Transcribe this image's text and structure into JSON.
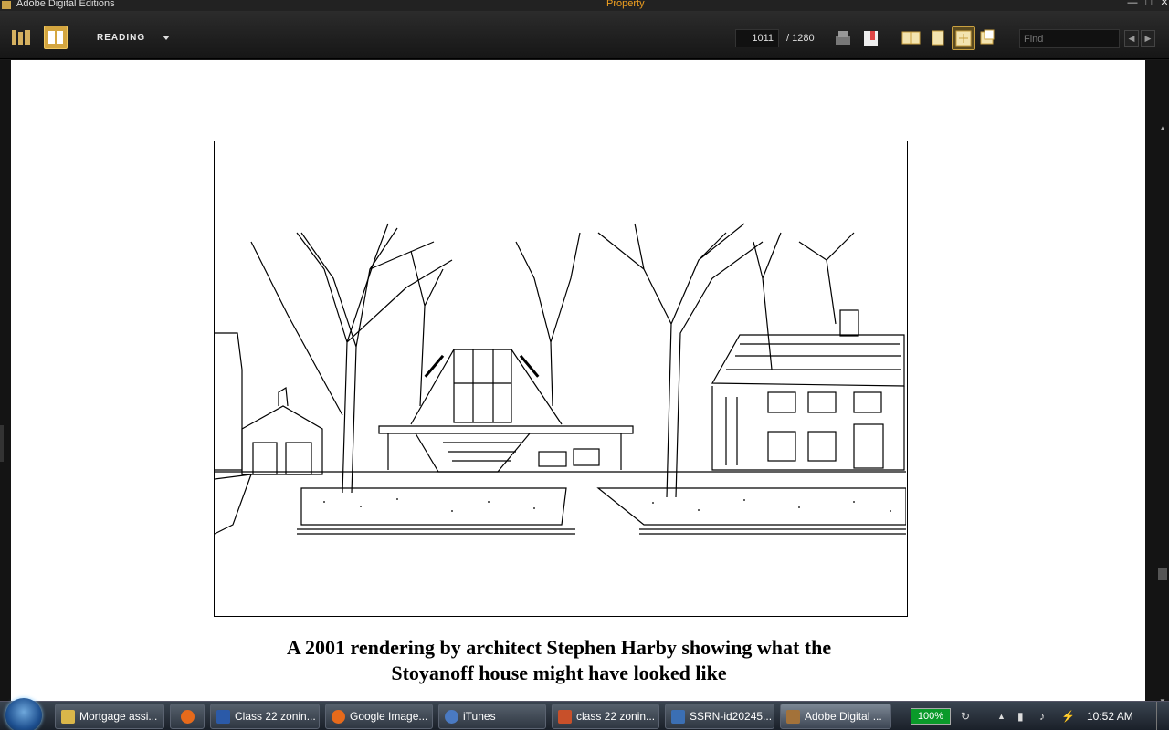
{
  "window": {
    "app_title": "Adobe Digital Editions",
    "doc_title": "Property"
  },
  "toolbar": {
    "view_mode_label": "READING",
    "page_current": "1011",
    "page_total": "/ 1280",
    "find_placeholder": "Find"
  },
  "document": {
    "caption_line1": "A 2001 rendering by architect Stephen Harby showing what the",
    "caption_line2": "Stoyanoff house might have looked like"
  },
  "taskbar": {
    "items": [
      {
        "label": "Mortgage assi...",
        "icon": "folder-icon",
        "color": "#d9b64a"
      },
      {
        "label": "",
        "icon": "firefox-icon",
        "color": "#e66a1b"
      },
      {
        "label": "Class 22 zonin...",
        "icon": "word-icon",
        "color": "#2b5aa8"
      },
      {
        "label": "Google Image...",
        "icon": "firefox-icon",
        "color": "#e66a1b"
      },
      {
        "label": "iTunes",
        "icon": "itunes-icon",
        "color": "#4a7ac2"
      },
      {
        "label": "class 22 zonin...",
        "icon": "powerpoint-icon",
        "color": "#c8502a"
      },
      {
        "label": "SSRN-id20245...",
        "icon": "pdf-icon",
        "color": "#3b6fb4"
      },
      {
        "label": "Adobe Digital ...",
        "icon": "ade-icon",
        "color": "#a3723a"
      }
    ],
    "battery": "100%",
    "clock": "10:52 AM"
  }
}
